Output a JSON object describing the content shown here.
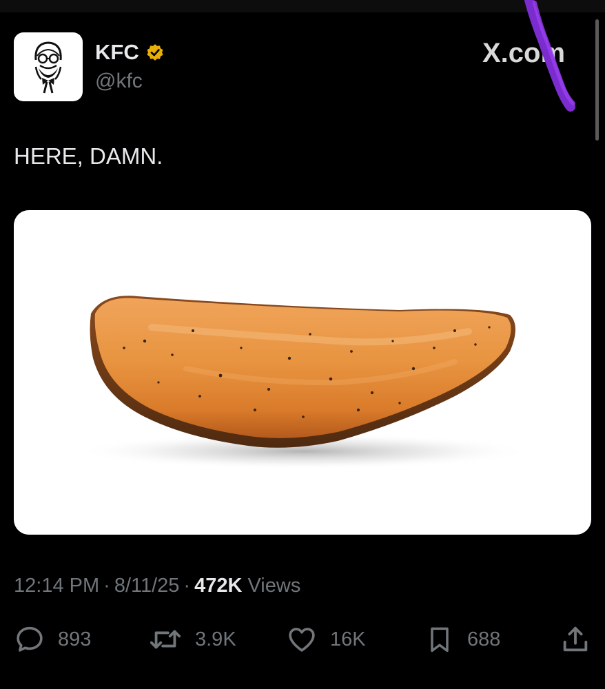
{
  "watermark": "X.com",
  "author": {
    "display_name": "KFC",
    "handle": "@kfc",
    "verified_color": "#f4c20d"
  },
  "tweet": {
    "text": "HERE, DAMN.",
    "time": "12:14 PM",
    "date": "8/11/25",
    "views_count": "472K",
    "views_label": "Views"
  },
  "actions": {
    "replies": "893",
    "reposts": "3.9K",
    "likes": "16K",
    "bookmarks": "688"
  },
  "icons": {
    "reply": "speech-bubble-icon",
    "repost": "repost-arrows-icon",
    "like": "heart-icon",
    "bookmark": "bookmark-icon",
    "share": "share-upload-icon"
  },
  "colors": {
    "background": "#000000",
    "text_primary": "#e7e9ea",
    "text_secondary": "#71767b",
    "scribble": "#8a2be2"
  }
}
